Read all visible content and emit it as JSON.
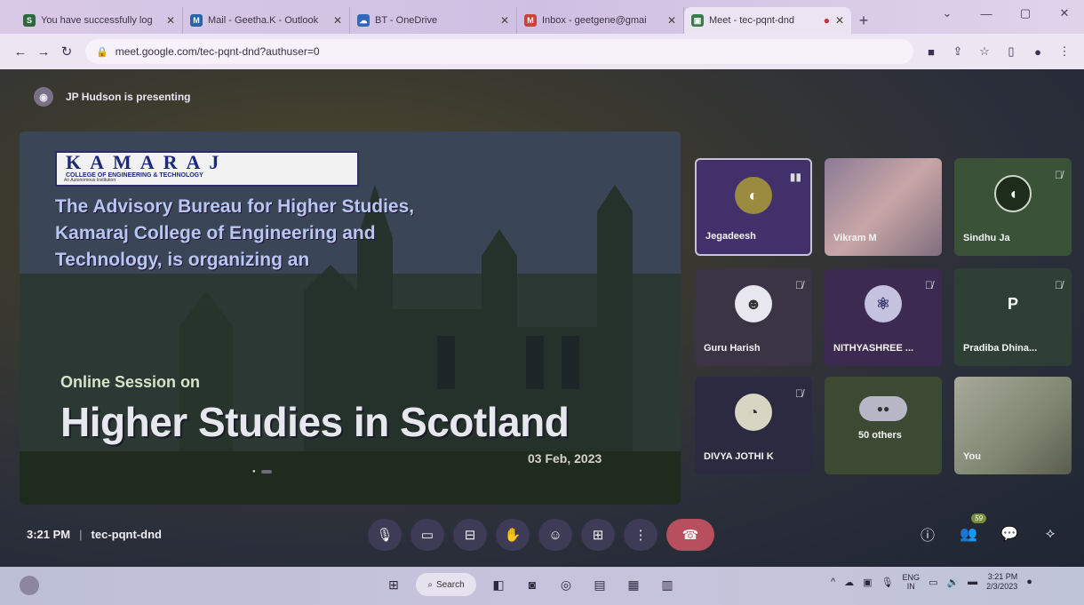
{
  "browser": {
    "tabs": [
      {
        "title": "You have successfully log",
        "color": "#2d6a3b",
        "glyph": "S",
        "active": false
      },
      {
        "title": "Mail - Geetha.K - Outlook",
        "color": "#2a63a8",
        "glyph": "M",
        "active": false
      },
      {
        "title": "BT - OneDrive",
        "color": "#3168b9",
        "glyph": "☁",
        "active": false
      },
      {
        "title": "Inbox - geetgene@gmai",
        "color": "#c5453a",
        "glyph": "M",
        "active": false
      },
      {
        "title": "Meet - tec-pqnt-dnd",
        "color": "#3a7d48",
        "glyph": "▣",
        "active": true
      }
    ],
    "new_tab": "+",
    "url": "meet.google.com/tec-pqnt-dnd?authuser=0"
  },
  "meet": {
    "presenting_text": "JP Hudson is presenting",
    "slide": {
      "logo_text": "KAMARAJ",
      "logo_sub": "COLLEGE OF ENGINEERING & TECHNOLOGY",
      "logo_tag": "An Autonomous Institution",
      "lead": "The Advisory Bureau for Higher Studies, Kamaraj College of Engineering and Technology, is organizing an",
      "online": "Online Session on",
      "headline": "Higher Studies in Scotland",
      "date": "03 Feb, 2023"
    },
    "participants": [
      {
        "name": "Jegadeesh",
        "initial": "",
        "muted": false
      },
      {
        "name": "Vikram M",
        "initial": "",
        "muted": false
      },
      {
        "name": "Sindhu Ja",
        "initial": "",
        "muted": true
      },
      {
        "name": "Guru Harish",
        "initial": "",
        "muted": true
      },
      {
        "name": "NITHYASHREE ...",
        "initial": "",
        "muted": true
      },
      {
        "name": "Pradiba Dhina...",
        "initial": "P",
        "muted": true
      },
      {
        "name": "DIVYA JOTHI K",
        "initial": "",
        "muted": true
      },
      {
        "name": "50 others",
        "initial": "",
        "muted": false
      },
      {
        "name": "You",
        "initial": "",
        "muted": false
      }
    ],
    "time": "3:21 PM",
    "meeting_code": "tec-pqnt-dnd",
    "people_count": "59"
  },
  "taskbar": {
    "search_label": "Search",
    "lang_top": "ENG",
    "lang_bottom": "IN",
    "clock_time": "3:21 PM",
    "clock_date": "2/3/2023"
  }
}
